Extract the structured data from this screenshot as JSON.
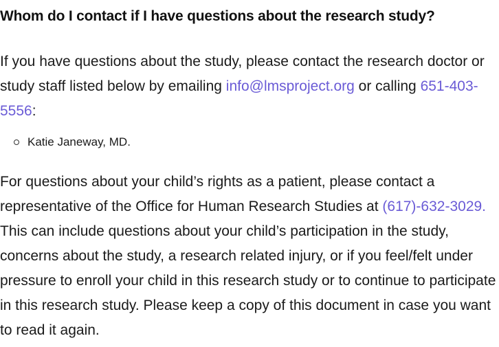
{
  "heading": "Whom do I contact if I have questions about the research study?",
  "paragraph1": {
    "text_before_email": "If you have questions about the study, please contact the research doctor or study staff listed below by emailing ",
    "email": "info@lmsproject.org",
    "text_between": " or calling ",
    "phone": "651-403-5556",
    "text_after": ":"
  },
  "contacts": [
    "Katie Janeway, MD."
  ],
  "paragraph2": {
    "text_before_phone": "For questions about your child’s rights as a patient, please contact a representative of the Office for Human Research Studies at ",
    "phone": "(617)-632-3029.",
    "text_after": " This can include questions about your child’s participation in the study, concerns about the study, a research related injury, or if you feel/felt under pressure to enroll your child in this research study or to continue to participate in this research study. Please keep a copy of this document in case you want to read it again."
  },
  "colors": {
    "link": "#6a5bd6",
    "text": "#1a1a1a"
  }
}
